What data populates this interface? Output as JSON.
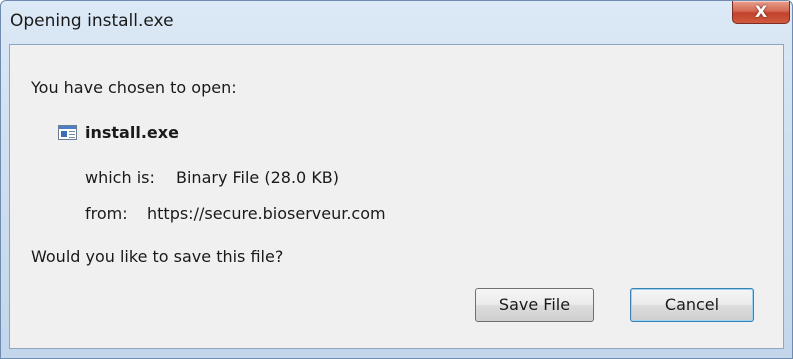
{
  "window": {
    "title": "Opening install.exe",
    "close_glyph": "X"
  },
  "dialog": {
    "intro": "You have chosen to open:",
    "file_icon": "executable-file-icon",
    "file_name": "install.exe",
    "type_label": "which is:",
    "type_value": "Binary File (28.0 KB)",
    "from_label": "from:",
    "from_value": "https://secure.bioserveur.com",
    "question": "Would you like to save this file?"
  },
  "buttons": {
    "save_label": "Save File",
    "cancel_label": "Cancel"
  },
  "colors": {
    "titlebar": "#cfe0f1",
    "client_bg": "#f0f0f0",
    "close_button": "#c2412a",
    "default_button_border": "#3c7fb1"
  }
}
